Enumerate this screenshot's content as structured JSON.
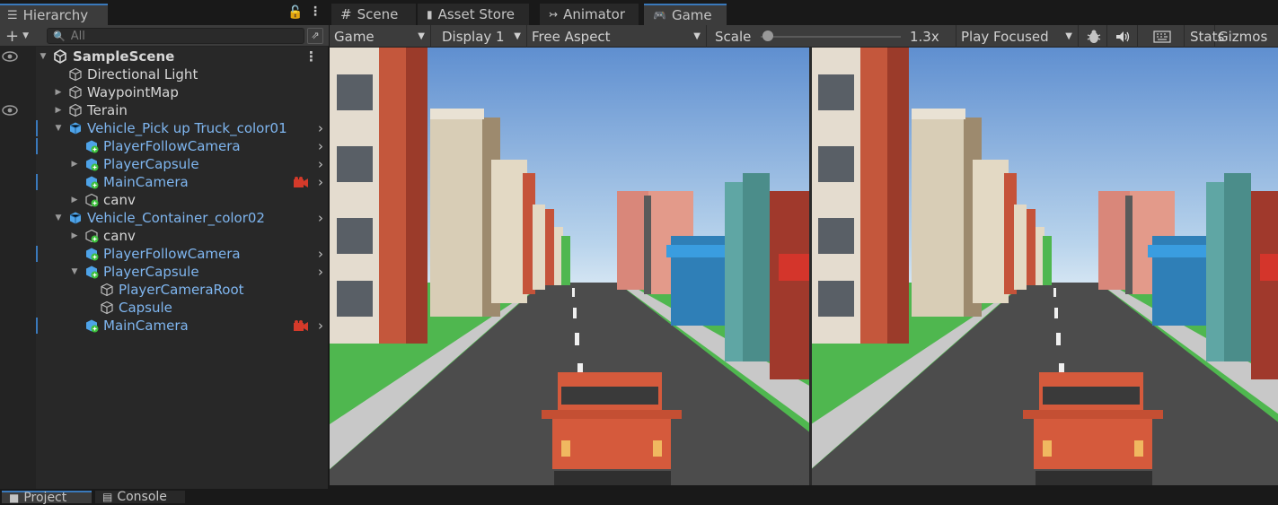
{
  "hierarchy": {
    "tab_label": "Hierarchy",
    "search_placeholder": "All",
    "scene_name": "SampleScene",
    "items": [
      {
        "label": "Directional Light"
      },
      {
        "label": "WaypointMap"
      },
      {
        "label": "Terain"
      },
      {
        "label": "Vehicle_Pick up Truck_color01"
      },
      {
        "label": "PlayerFollowCamera"
      },
      {
        "label": "PlayerCapsule"
      },
      {
        "label": "MainCamera"
      },
      {
        "label": "canv"
      },
      {
        "label": "Vehicle_Container_color02"
      },
      {
        "label": "canv"
      },
      {
        "label": "PlayerFollowCamera"
      },
      {
        "label": "PlayerCapsule"
      },
      {
        "label": "PlayerCameraRoot"
      },
      {
        "label": "Capsule"
      },
      {
        "label": "MainCamera"
      }
    ]
  },
  "tabs": {
    "scene": "Scene",
    "asset_store": "Asset Store",
    "animator": "Animator",
    "game": "Game"
  },
  "game_toolbar": {
    "view_mode": "Game",
    "display": "Display 1",
    "aspect": "Free Aspect",
    "scale_label": "Scale",
    "scale_value": "1.3x",
    "scale_fraction": 0.05,
    "play_mode": "Play Focused",
    "stats": "Stats",
    "gizmos": "Gizmos"
  },
  "bottom_tabs": {
    "project": "Project",
    "console": "Console"
  },
  "colors": {
    "accent": "#3a79bb",
    "prefab_blue": "#7fb6f0",
    "panel": "#282828",
    "toolbar": "#3c3c3c"
  }
}
